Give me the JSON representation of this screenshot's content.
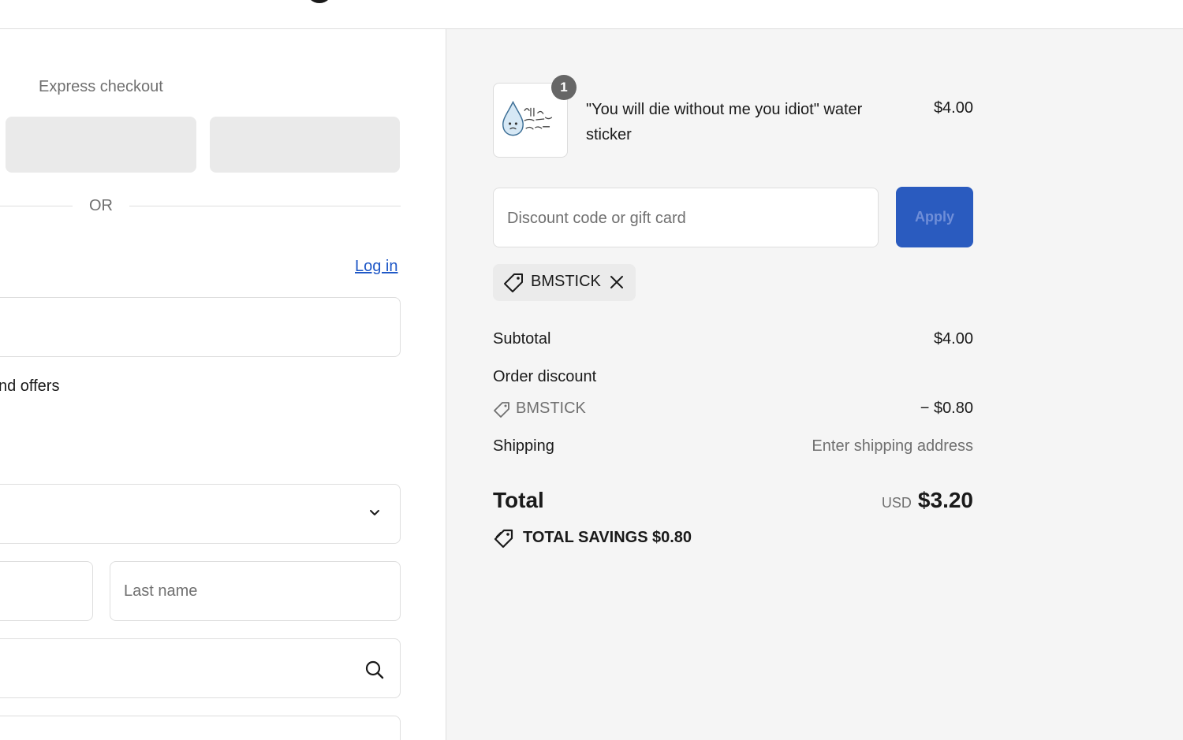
{
  "colors": {
    "accent": "#2a5bbf",
    "link": "#1f58c7",
    "summary_background": "#f5f5f5",
    "muted_text": "#707070"
  },
  "checkout": {
    "express_title": "Express checkout",
    "or_divider": "OR",
    "login_link": "Log in",
    "offers_text": "nd offers",
    "last_name_placeholder": "Last name"
  },
  "order_summary": {
    "item": {
      "quantity": "1",
      "name": "\"You will die without me you idiot\" water sticker",
      "price": "$4.00",
      "thumbnail_alt": "You'll die without me you idiot"
    },
    "discount": {
      "placeholder": "Discount code or gift card",
      "apply_label": "Apply",
      "applied_code": "BMSTICK"
    },
    "lines": {
      "subtotal_label": "Subtotal",
      "subtotal_value": "$4.00",
      "order_discount_label": "Order discount",
      "discount_code": "BMSTICK",
      "discount_value": "− $0.80",
      "shipping_label": "Shipping",
      "shipping_value": "Enter shipping address"
    },
    "total": {
      "label": "Total",
      "currency": "USD",
      "amount": "$3.20",
      "savings_label": "TOTAL SAVINGS",
      "savings_amount": "$0.80"
    }
  },
  "icons": [
    "tag-icon",
    "close-icon",
    "chevron-down-icon",
    "search-icon"
  ]
}
